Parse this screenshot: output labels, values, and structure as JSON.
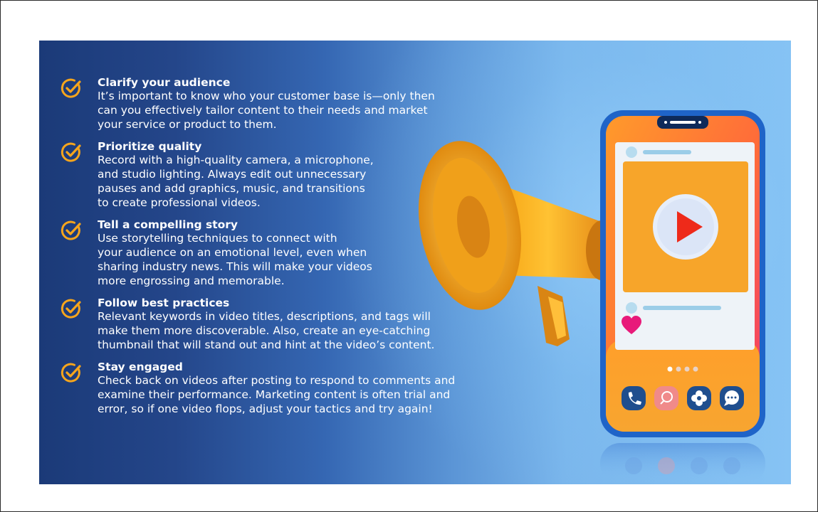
{
  "colors": {
    "check": "#f6a51c",
    "banner_dark": "#1b3a78",
    "banner_light": "#86c3f4"
  },
  "tips": [
    {
      "icon": "check-circle-icon",
      "title": "Clarify your audience",
      "body": "It’s important to know who your customer base is—only then\ncan you effectively tailor content to their needs and market\nyour service or product to them."
    },
    {
      "icon": "check-circle-icon",
      "title": "Prioritize quality",
      "body": "Record with a high-quality camera, a microphone,\nand studio lighting. Always edit out unnecessary\npauses and add graphics, music, and transitions\nto create professional videos."
    },
    {
      "icon": "check-circle-icon",
      "title": "Tell a compelling story",
      "body": "Use storytelling techniques to connect with\nyour audience on an emotional level, even when\nsharing industry news. This will make your videos\nmore engrossing and memorable."
    },
    {
      "icon": "check-circle-icon",
      "title": "Follow best practices",
      "body": "Relevant keywords in video titles, descriptions, and tags will\nmake them more discoverable. Also, create an eye-catching\nthumbnail that will stand out and hint at the video’s content."
    },
    {
      "icon": "check-circle-icon",
      "title": "Stay engaged",
      "body": "Check back on videos after posting to respond to comments and\nexamine their performance. Marketing content is often trial and\nerror, so if one video flops, adjust your tactics and try again!"
    }
  ],
  "illustration": {
    "megaphone_icon": "megaphone-icon",
    "phone_icon": "smartphone-icon",
    "play_icon": "play-button-icon",
    "heart_icon": "heart-icon",
    "dock_icons": [
      "phone-call-icon",
      "search-icon",
      "flower-icon",
      "chat-bubble-icon"
    ]
  }
}
